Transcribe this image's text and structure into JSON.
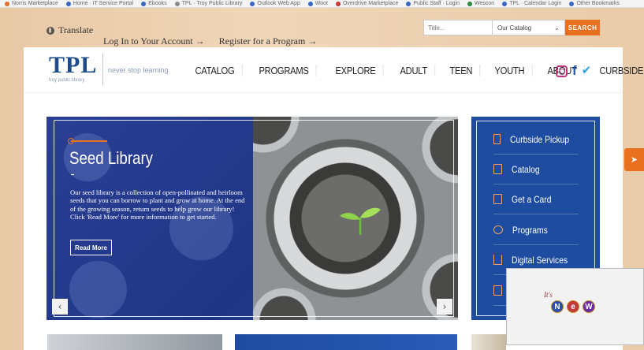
{
  "bookmarks": [
    "Norris Marketplace",
    "Home · IT Service Portal",
    "Ebooks",
    "TPL · Troy Public Library",
    "Outlook Web App",
    "Woot",
    "Overdrive Marketplace",
    "Public Staff · Login",
    "Wescon",
    "TPL · Calendar Login",
    "Other Bookmarks"
  ],
  "utility": {
    "translate_label": "Translate",
    "login_link": "Log In to Your Account →",
    "register_link": "Register for a Program →"
  },
  "search": {
    "placeholder": "Title...",
    "scope_selected": "Our Catalog",
    "button_label": "SEARCH"
  },
  "header": {
    "logo_text": "TPL",
    "logo_subtext": "troy public library",
    "tagline": "never stop learning",
    "nav": [
      "CATALOG",
      "PROGRAMS",
      "EXPLORE",
      "ADULT",
      "TEEN",
      "YOUTH",
      "ABOUT",
      "CURBSIDE"
    ]
  },
  "hero": {
    "title": "Seed Library",
    "body": "Our seed library is a collection of open-pollinated and heirloom seeds that you can borrow to plant and grow at home. At the end of the growing season, return seeds to help grow our library! Click 'Read More' for more information to get started.",
    "cta_label": "Read More",
    "prev_arrow": "‹",
    "next_arrow": "›"
  },
  "quick_links": [
    "Curbside Pickup",
    "Catalog",
    "Get a Card",
    "Programs",
    "Digital Services"
  ],
  "overlay": {
    "its_text": "It's",
    "letters": [
      "N",
      "e",
      "W"
    ]
  },
  "colors": {
    "brand_blue": "#1d4ca0",
    "accent_orange": "#e8701e",
    "hero_blue": "#2a3f95"
  }
}
